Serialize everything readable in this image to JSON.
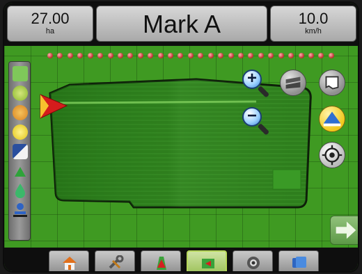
{
  "header": {
    "area_value": "27.00",
    "area_unit": "ha",
    "title": "Mark A",
    "speed_value": "10.0",
    "speed_unit": "km/h"
  },
  "nozzle_count": 29,
  "left_panel_icons": [
    "work-light-icon",
    "tractor-green-icon",
    "boom-orange-icon",
    "flow-yellow-icon",
    "gps-tilt-icon",
    "guidance-arrow-icon",
    "tank-icon",
    "boom-height-icon"
  ],
  "right_controls": [
    "zoom-in-icon",
    "zoom-out-icon",
    "perspective-view-icon",
    "map-view-icon",
    "guidance-mode-icon",
    "target-icon"
  ],
  "bottom_nav": [
    {
      "name": "home",
      "icon": "home-icon",
      "active": false
    },
    {
      "name": "setup",
      "icon": "tools-icon",
      "active": false
    },
    {
      "name": "vehicle-view",
      "icon": "vehicle-icon",
      "active": false
    },
    {
      "name": "field-view",
      "icon": "map-marker-icon",
      "active": true
    },
    {
      "name": "real-view",
      "icon": "camera-icon",
      "active": false
    },
    {
      "name": "data",
      "icon": "files-icon",
      "active": false
    }
  ],
  "colors": {
    "background_grid": "#3f9a22",
    "accent_active": "#b7d85a",
    "nozzle": "#c33b3b"
  }
}
